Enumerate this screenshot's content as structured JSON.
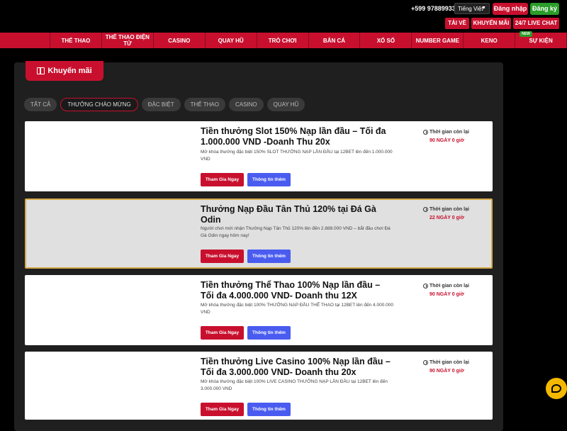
{
  "topbar": {
    "phone": "+599 97889933",
    "language": "Tiếng Việt",
    "login": "Đăng nhập",
    "register": "Đăng ký",
    "download": "TẢI VỀ",
    "promotions": "KHUYẾN MÃI",
    "live_chat": "24/7 LIVE CHAT"
  },
  "nav": {
    "items": [
      "THỂ THAO",
      "THỂ THAO ĐIỆN TỬ",
      "CASINO",
      "QUAY HŨ",
      "TRÒ CHƠI",
      "BẮN CÁ",
      "XỔ SỐ",
      "NUMBER GAME",
      "KENO",
      "SỰ KIỆN"
    ],
    "new_badge": "NEW"
  },
  "promo": {
    "title": "Khuyến mãi",
    "filters": [
      "TẤT CẢ",
      "THƯỞNG CHÀO MỪNG",
      "ĐẶC BIỆT",
      "THỂ THAO",
      "CASINO",
      "QUAY HŨ"
    ],
    "active_filter": 1
  },
  "cards": [
    {
      "title": "Tiền thưởng Slot 150% Nạp lần đầu – Tối đa 1.000.000 VND -Doanh Thu 20x",
      "desc": "Mở khóa thưởng đặc biệt 150% SLOT THƯỞNG NẠP LẦN ĐẦU tại 12BET lên đến 1.000.000 VND",
      "join": "Tham Gia Ngay",
      "info": "Thông tin thêm",
      "time_label": "Thời gian còn lại",
      "time_value": "90 NGÀY 0 giờ"
    },
    {
      "title": "Thưởng Nạp Đầu Tân Thủ 120% tại Đá Gà Odin",
      "desc": "Người chơi mới nhận Thưởng Nạp Tân Thủ 120% lên đến 2.888.000 VND – bắt đầu chơi Đá Gà Odin ngay hôm nay!",
      "join": "Tham Gia Ngay",
      "info": "Thông tin thêm",
      "time_label": "Thời gian còn lại",
      "time_value": "22 NGÀY 0 giờ"
    },
    {
      "title": "Tiền thưởng Thể Thao 100% Nạp lần đầu – Tối đa 4.000.000 VND- Doanh thu 12X",
      "desc": "Mở khóa thưởng đặc biệt 100% THƯỞNG NẠP ĐẦU THỂ THAO tại 12BET lên đến 4.000.000 VND",
      "join": "Tham Gia Ngay",
      "info": "Thông tin thêm",
      "time_label": "Thời gian còn lại",
      "time_value": "90 NGÀY 0 giờ"
    },
    {
      "title": "Tiền thưởng Live Casino 100% Nạp lần đầu – Tối đa 3.000.000 VND- Doanh thu 20x",
      "desc": "Mở khóa thưởng đặc biệt 100% LIVE CASINO THƯỞNG NẠP LẦN ĐẦU tại 12BET lên đến 3.000.000 VND",
      "join": "Tham Gia Ngay",
      "info": "Thông tin thêm",
      "time_label": "Thời gian còn lại",
      "time_value": "90 NGÀY 0 giờ"
    }
  ],
  "colors": {
    "brand_red": "#c8102e",
    "register_green": "#2a9d2a",
    "info_blue": "#4a5cf0",
    "chat_yellow": "#f5b800"
  }
}
